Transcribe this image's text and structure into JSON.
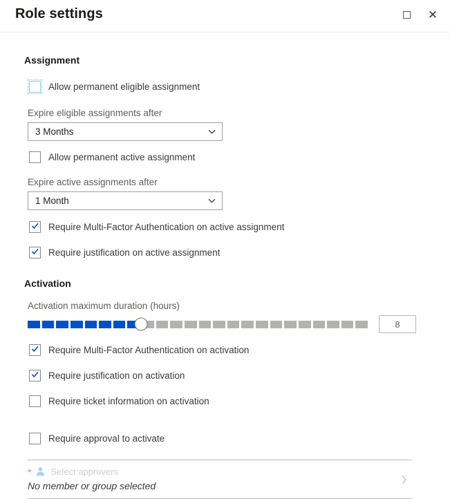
{
  "window": {
    "title": "Role settings",
    "maximize_icon": "maximize-icon",
    "close_icon": "close-icon"
  },
  "assignment": {
    "heading": "Assignment",
    "allow_permanent_eligible": {
      "label": "Allow permanent eligible assignment",
      "checked": false,
      "focused": true
    },
    "expire_eligible": {
      "label": "Expire eligible assignments after",
      "value": "3 Months"
    },
    "allow_permanent_active": {
      "label": "Allow permanent active assignment",
      "checked": false
    },
    "expire_active": {
      "label": "Expire active assignments after",
      "value": "1 Month"
    },
    "require_mfa_active": {
      "label": "Require Multi-Factor Authentication on active assignment",
      "checked": true
    },
    "require_justification_active": {
      "label": "Require justification on active assignment",
      "checked": true
    }
  },
  "activation": {
    "heading": "Activation",
    "duration": {
      "label": "Activation maximum duration (hours)",
      "value": "8",
      "min": 0,
      "max": 24,
      "segments": 24,
      "filled_segments": 8
    },
    "require_mfa": {
      "label": "Require Multi-Factor Authentication on activation",
      "checked": true
    },
    "require_justification": {
      "label": "Require justification on activation",
      "checked": true
    },
    "require_ticket": {
      "label": "Require ticket information on activation",
      "checked": false
    },
    "require_approval": {
      "label": "Require approval to activate",
      "checked": false
    },
    "approvers": {
      "required_marker": "*",
      "icon": "person-icon",
      "caption": "Select approvers",
      "empty_text": "No member or group selected",
      "chevron_icon": "chevron-right-icon"
    }
  },
  "colors": {
    "accent": "#0050c8",
    "track_off": "#b4b2b0",
    "required": "#f2767a",
    "text": "#3b3a39",
    "muted": "#605e5c"
  }
}
